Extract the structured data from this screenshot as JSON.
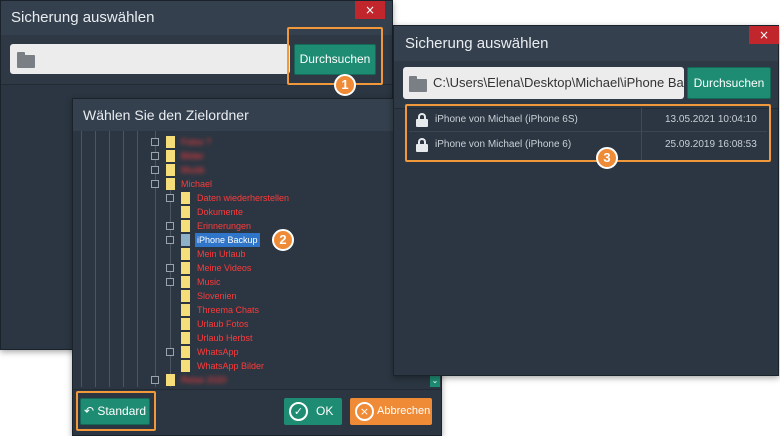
{
  "window1": {
    "title": "Sicherung auswählen",
    "close": "×",
    "browse_label": "Durchsuchen",
    "path_value": "",
    "badge": "1"
  },
  "folder_dialog": {
    "title": "Wählen Sie den Zielordner",
    "tree": [
      {
        "label": "Fotos ?",
        "blurred": true
      },
      {
        "label": "Bilder",
        "blurred": true
      },
      {
        "label": "Musik",
        "blurred": true
      },
      {
        "label": "Michael",
        "blurred": false
      },
      {
        "label": "Daten wiederherstellen",
        "blurred": false
      },
      {
        "label": "Dokumente",
        "blurred": false
      },
      {
        "label": "Erinnerungen",
        "blurred": false
      },
      {
        "label": "iPhone Backup",
        "blurred": false,
        "selected": true
      },
      {
        "label": "Mein Urlaub",
        "blurred": false
      },
      {
        "label": "Meine Videos",
        "blurred": false
      },
      {
        "label": "Music",
        "blurred": false
      },
      {
        "label": "Slovenien",
        "blurred": false
      },
      {
        "label": "Threema Chats",
        "blurred": false
      },
      {
        "label": "Urlaub Fotos",
        "blurred": false
      },
      {
        "label": "Urlaub Herbst",
        "blurred": false
      },
      {
        "label": "WhatsApp",
        "blurred": false
      },
      {
        "label": "WhatsApp Bilder",
        "blurred": false
      },
      {
        "label": "Reise 2020",
        "blurred": true
      },
      {
        "label": "",
        "blurred": true
      }
    ],
    "badge": "2",
    "standard_label": "Standard",
    "ok_label": "OK",
    "cancel_label": "Abbrechen",
    "colors": {
      "ok": "#1e8c72",
      "cancel": "#ef8a36",
      "selection": "#2f75c9",
      "folder_text": "#ff3a3a"
    }
  },
  "window3": {
    "title": "Sicherung auswählen",
    "close": "×",
    "path_value": "C:\\Users\\Elena\\Desktop\\Michael\\iPhone Backup",
    "browse_label": "Durchsuchen",
    "backups": [
      {
        "name": "iPhone von Michael (iPhone 6S)",
        "date": "13.05.2021 10:04:10"
      },
      {
        "name": "iPhone von Michael (iPhone 6)",
        "date": "25.09.2019 16:08:53"
      }
    ],
    "badge": "3"
  }
}
